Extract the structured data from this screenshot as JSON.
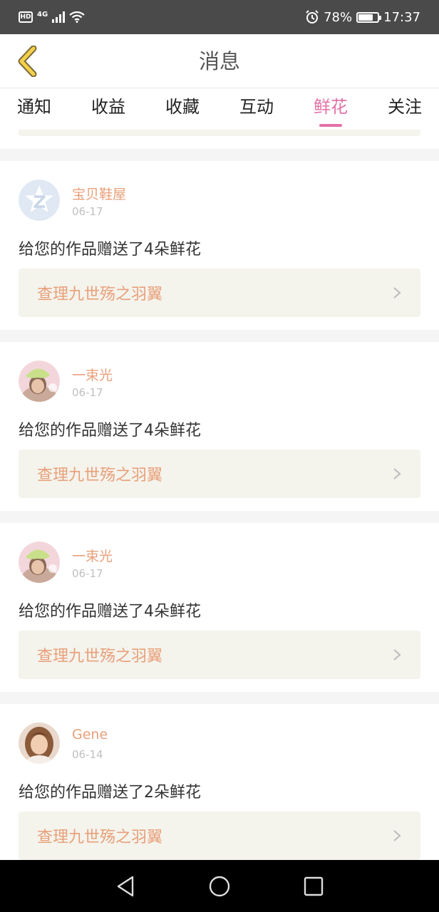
{
  "status_bar": {
    "hd": "HD",
    "network": "4G",
    "battery_percent": "78%",
    "battery_level": 0.78,
    "time": "17:37",
    "icons": [
      "signal-icon",
      "wifi-icon",
      "alarm-icon",
      "battery-icon"
    ]
  },
  "header": {
    "title": "消息",
    "back_icon": "chevron-left-icon",
    "accent": "#e371a6"
  },
  "tabs": [
    {
      "label": "通知",
      "active": false
    },
    {
      "label": "收益",
      "active": false
    },
    {
      "label": "收藏",
      "active": false
    },
    {
      "label": "互动",
      "active": false
    },
    {
      "label": "鲜花",
      "active": true
    },
    {
      "label": "关注",
      "active": false
    }
  ],
  "messages": [
    {
      "sender": "宝贝鞋屋",
      "date": "06-17",
      "text": "给您的作品赠送了4朵鲜花",
      "book": "查理九世殇之羽翼",
      "avatar": "qq-default-avatar"
    },
    {
      "sender": "一束光",
      "date": "06-17",
      "text": "给您的作品赠送了4朵鲜花",
      "book": "查理九世殇之羽翼",
      "avatar": "girl-green-hat-avatar"
    },
    {
      "sender": "一束光",
      "date": "06-17",
      "text": "给您的作品赠送了4朵鲜花",
      "book": "查理九世殇之羽翼",
      "avatar": "girl-green-hat-avatar"
    },
    {
      "sender": "Gene",
      "date": "06-14",
      "text": "给您的作品赠送了2朵鲜花",
      "book": "查理九世殇之羽翼",
      "avatar": "girl-photo-avatar"
    }
  ],
  "colors": {
    "sender": "#e8a07a",
    "book_link_bg": "#f4f3ec",
    "status_bar_bg": "#4a4a4a"
  },
  "nav_bar": {
    "icons": [
      "back-triangle-icon",
      "home-circle-icon",
      "recents-square-icon"
    ]
  }
}
